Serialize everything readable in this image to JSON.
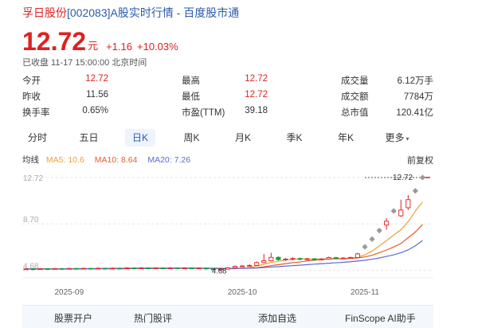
{
  "header": {
    "stock_name": "孚日股份",
    "code": "[002083]",
    "title_suffix": "A股实时行情 - 百度股市通"
  },
  "quote": {
    "price": "12.72",
    "unit": "元",
    "change": "+1.16",
    "change_pct": "+10.03%",
    "status": "已收盘 11-17 15:00:00 北京时间"
  },
  "stats": [
    [
      {
        "label": "今开",
        "value": "12.72",
        "color": "red"
      },
      {
        "label": "最高",
        "value": "12.72",
        "color": "red"
      },
      {
        "label": "成交量",
        "value": "6.12万手",
        "color": "dark"
      }
    ],
    [
      {
        "label": "昨收",
        "value": "11.56",
        "color": "dark"
      },
      {
        "label": "最低",
        "value": "12.72",
        "color": "red"
      },
      {
        "label": "成交额",
        "value": "7784万",
        "color": "dark"
      }
    ],
    [
      {
        "label": "换手率",
        "value": "0.65%",
        "color": "dark"
      },
      {
        "label": "市盈(TTM)",
        "value": "39.18",
        "color": "dark"
      },
      {
        "label": "总市值",
        "value": "120.41亿",
        "color": "dark"
      }
    ]
  ],
  "tabs": [
    {
      "label": "分时",
      "active": false
    },
    {
      "label": "五日",
      "active": false
    },
    {
      "label": "日K",
      "active": true
    },
    {
      "label": "周K",
      "active": false
    },
    {
      "label": "月K",
      "active": false
    },
    {
      "label": "季K",
      "active": false
    },
    {
      "label": "年K",
      "active": false
    },
    {
      "label": "更多",
      "active": false,
      "dropdown": true
    }
  ],
  "ma": {
    "title": "均线",
    "ma5": "MA5: 10.6",
    "ma10": "MA10: 8.64",
    "ma20": "MA20: 7.26",
    "adjust": "前复权"
  },
  "colors": {
    "up": "#e02020",
    "down": "#1a9a3a",
    "ma5": "#f0a030",
    "ma10": "#e85a2a",
    "ma20": "#5a6ad8",
    "limit": "#999999"
  },
  "chart_data": {
    "type": "candlestick",
    "y_tick_labels": [
      "12.72",
      "8.70",
      "4.68"
    ],
    "ylim": [
      4.3,
      13.2
    ],
    "x_tick_labels": [
      "2025-09",
      "2025-10",
      "2025-11"
    ],
    "x_tick_index": [
      6,
      30,
      47
    ],
    "price_labels": {
      "high": "12.72",
      "low": "4.68"
    },
    "candles": [
      {
        "o": 4.78,
        "c": 4.8,
        "h": 4.86,
        "l": 4.72
      },
      {
        "o": 4.8,
        "c": 4.79,
        "h": 4.85,
        "l": 4.74
      },
      {
        "o": 4.79,
        "c": 4.82,
        "h": 4.88,
        "l": 4.75
      },
      {
        "o": 4.82,
        "c": 4.8,
        "h": 4.86,
        "l": 4.76
      },
      {
        "o": 4.8,
        "c": 4.83,
        "h": 4.89,
        "l": 4.77
      },
      {
        "o": 4.83,
        "c": 4.81,
        "h": 4.87,
        "l": 4.78
      },
      {
        "o": 4.81,
        "c": 4.84,
        "h": 4.9,
        "l": 4.78
      },
      {
        "o": 4.84,
        "c": 4.82,
        "h": 4.88,
        "l": 4.79
      },
      {
        "o": 4.82,
        "c": 4.85,
        "h": 4.9,
        "l": 4.79
      },
      {
        "o": 4.85,
        "c": 4.83,
        "h": 4.89,
        "l": 4.8
      },
      {
        "o": 4.83,
        "c": 4.86,
        "h": 4.92,
        "l": 4.8
      },
      {
        "o": 4.86,
        "c": 4.84,
        "h": 4.9,
        "l": 4.81
      },
      {
        "o": 4.84,
        "c": 4.86,
        "h": 4.92,
        "l": 4.81
      },
      {
        "o": 4.86,
        "c": 4.85,
        "h": 4.91,
        "l": 4.82
      },
      {
        "o": 4.85,
        "c": 4.88,
        "h": 4.94,
        "l": 4.82
      },
      {
        "o": 4.88,
        "c": 4.86,
        "h": 4.92,
        "l": 4.83
      },
      {
        "o": 4.86,
        "c": 4.89,
        "h": 4.95,
        "l": 4.83
      },
      {
        "o": 4.89,
        "c": 4.87,
        "h": 4.93,
        "l": 4.84
      },
      {
        "o": 4.87,
        "c": 4.88,
        "h": 4.94,
        "l": 4.84
      },
      {
        "o": 4.88,
        "c": 4.86,
        "h": 4.92,
        "l": 4.83
      },
      {
        "o": 4.86,
        "c": 4.89,
        "h": 4.95,
        "l": 4.83
      },
      {
        "o": 4.89,
        "c": 4.87,
        "h": 4.93,
        "l": 4.84
      },
      {
        "o": 4.87,
        "c": 4.88,
        "h": 4.94,
        "l": 4.84
      },
      {
        "o": 4.88,
        "c": 4.86,
        "h": 4.92,
        "l": 4.83
      },
      {
        "o": 4.86,
        "c": 4.87,
        "h": 4.93,
        "l": 4.8
      },
      {
        "o": 4.87,
        "c": 4.8,
        "h": 4.9,
        "l": 4.74
      },
      {
        "o": 4.8,
        "c": 4.72,
        "h": 4.83,
        "l": 4.68
      },
      {
        "o": 4.72,
        "c": 4.78,
        "h": 4.82,
        "l": 4.7
      },
      {
        "o": 4.78,
        "c": 4.9,
        "h": 4.96,
        "l": 4.76
      },
      {
        "o": 4.9,
        "c": 5.02,
        "h": 5.1,
        "l": 4.88
      },
      {
        "o": 5.02,
        "c": 5.05,
        "h": 5.14,
        "l": 4.98
      },
      {
        "o": 5.05,
        "c": 5.1,
        "h": 5.2,
        "l": 5.0
      },
      {
        "o": 5.1,
        "c": 5.35,
        "h": 5.45,
        "l": 5.08
      },
      {
        "o": 5.35,
        "c": 5.5,
        "h": 6.1,
        "l": 5.3
      },
      {
        "o": 5.5,
        "c": 5.8,
        "h": 6.2,
        "l": 5.45
      },
      {
        "o": 5.8,
        "c": 5.6,
        "h": 5.9,
        "l": 5.5
      },
      {
        "o": 5.6,
        "c": 5.65,
        "h": 5.75,
        "l": 5.5
      },
      {
        "o": 5.65,
        "c": 5.7,
        "h": 5.8,
        "l": 5.55
      },
      {
        "o": 5.7,
        "c": 5.62,
        "h": 5.78,
        "l": 5.55
      },
      {
        "o": 5.62,
        "c": 5.68,
        "h": 5.76,
        "l": 5.55
      },
      {
        "o": 5.68,
        "c": 5.6,
        "h": 5.74,
        "l": 5.5
      },
      {
        "o": 5.6,
        "c": 5.66,
        "h": 5.72,
        "l": 5.52
      },
      {
        "o": 5.66,
        "c": 5.78,
        "h": 5.86,
        "l": 5.6
      },
      {
        "o": 5.78,
        "c": 5.72,
        "h": 5.84,
        "l": 5.64
      },
      {
        "o": 5.72,
        "c": 5.74,
        "h": 5.82,
        "l": 5.66
      },
      {
        "o": 5.74,
        "c": 5.78,
        "h": 5.86,
        "l": 5.68
      },
      {
        "o": 5.78,
        "c": 6.1,
        "h": 6.2,
        "l": 5.74
      },
      {
        "o": 6.1,
        "c": 6.71,
        "h": 6.71,
        "l": 6.71
      },
      {
        "o": 7.38,
        "c": 7.38,
        "h": 7.38,
        "l": 7.38
      },
      {
        "o": 8.12,
        "c": 8.12,
        "h": 8.12,
        "l": 8.12
      },
      {
        "o": 8.6,
        "c": 8.93,
        "h": 9.2,
        "l": 8.2
      },
      {
        "o": 9.2,
        "c": 9.82,
        "h": 9.82,
        "l": 9.82
      },
      {
        "o": 9.4,
        "c": 9.9,
        "h": 10.8,
        "l": 9.3
      },
      {
        "o": 10.1,
        "c": 10.8,
        "h": 11.2,
        "l": 9.9
      },
      {
        "o": 11.56,
        "c": 11.56,
        "h": 11.56,
        "l": 11.56
      },
      {
        "o": 12.72,
        "c": 12.72,
        "h": 12.72,
        "l": 12.72
      }
    ],
    "limit_up_index": [
      47,
      48,
      49,
      51,
      54,
      55
    ],
    "series": [
      {
        "name": "MA5",
        "values": [
          4.8,
          4.8,
          4.8,
          4.8,
          4.81,
          4.81,
          4.82,
          4.83,
          4.83,
          4.83,
          4.84,
          4.84,
          4.85,
          4.85,
          4.86,
          4.86,
          4.87,
          4.87,
          4.87,
          4.87,
          4.87,
          4.87,
          4.87,
          4.87,
          4.87,
          4.85,
          4.82,
          4.8,
          4.79,
          4.82,
          4.85,
          4.91,
          5.05,
          5.2,
          5.36,
          5.45,
          5.58,
          5.64,
          5.66,
          5.65,
          5.66,
          5.66,
          5.68,
          5.7,
          5.71,
          5.74,
          5.82,
          6.01,
          6.34,
          6.79,
          7.25,
          7.73,
          8.19,
          8.89,
          9.81,
          10.6
        ]
      },
      {
        "name": "MA10",
        "values": [
          4.8,
          4.8,
          4.8,
          4.8,
          4.8,
          4.8,
          4.81,
          4.81,
          4.82,
          4.82,
          4.82,
          4.83,
          4.84,
          4.84,
          4.85,
          4.85,
          4.86,
          4.86,
          4.86,
          4.87,
          4.87,
          4.87,
          4.87,
          4.87,
          4.87,
          4.86,
          4.85,
          4.84,
          4.83,
          4.84,
          4.85,
          4.86,
          4.9,
          4.98,
          5.08,
          5.17,
          5.25,
          5.34,
          5.4,
          5.5,
          5.55,
          5.61,
          5.66,
          5.67,
          5.68,
          5.71,
          5.75,
          5.84,
          5.98,
          6.2,
          6.43,
          6.7,
          7.0,
          7.5,
          8.0,
          8.64
        ]
      },
      {
        "name": "MA20",
        "values": [
          4.8,
          4.8,
          4.8,
          4.8,
          4.8,
          4.8,
          4.8,
          4.8,
          4.81,
          4.81,
          4.81,
          4.81,
          4.82,
          4.82,
          4.82,
          4.83,
          4.83,
          4.83,
          4.84,
          4.84,
          4.84,
          4.85,
          4.85,
          4.85,
          4.86,
          4.85,
          4.85,
          4.85,
          4.84,
          4.85,
          4.85,
          4.86,
          4.88,
          4.92,
          4.96,
          5.0,
          5.04,
          5.08,
          5.12,
          5.17,
          5.21,
          5.25,
          5.29,
          5.33,
          5.37,
          5.42,
          5.48,
          5.55,
          5.64,
          5.75,
          5.88,
          6.02,
          6.2,
          6.45,
          6.8,
          7.26
        ]
      }
    ]
  },
  "footer": {
    "buttons": [
      "股票开户",
      "热门股评",
      "添加自选",
      "FinScope AI助手"
    ]
  }
}
